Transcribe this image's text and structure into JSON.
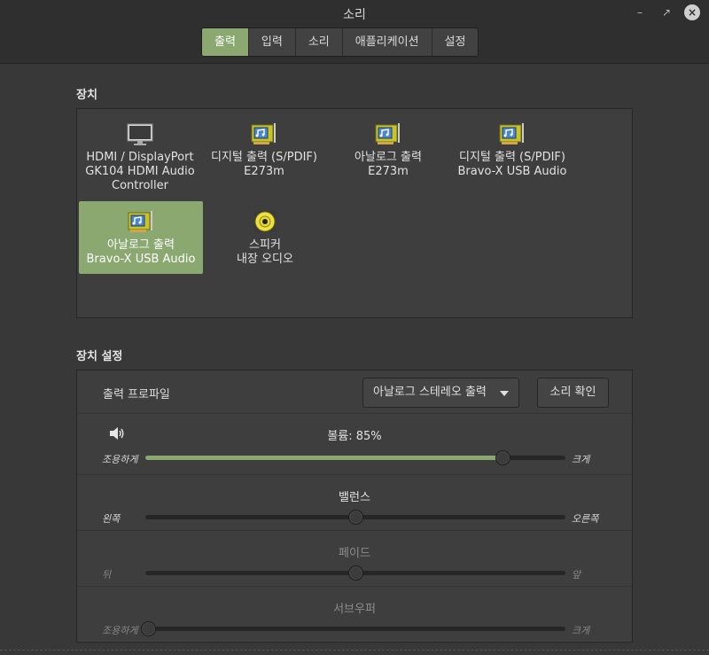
{
  "window": {
    "title": "소리"
  },
  "tabs": [
    {
      "label": "출력",
      "active": true
    },
    {
      "label": "입력",
      "active": false
    },
    {
      "label": "소리",
      "active": false
    },
    {
      "label": "애플리케이션",
      "active": false
    },
    {
      "label": "설정",
      "active": false
    }
  ],
  "devices_section": {
    "label": "장치",
    "devices": [
      {
        "line1": "HDMI / DisplayPort",
        "line2": "GK104 HDMI Audio",
        "line3": "Controller",
        "icon": "monitor-icon",
        "selected": false
      },
      {
        "line1": "디지털 출력 (S/PDIF)",
        "line2": "E273m",
        "icon": "sound-card-icon",
        "selected": false
      },
      {
        "line1": "아날로그 출력",
        "line2": "E273m",
        "icon": "sound-card-icon",
        "selected": false
      },
      {
        "line1": "디지털 출력 (S/PDIF)",
        "line2": "Bravo-X USB Audio",
        "icon": "sound-card-icon",
        "selected": false
      },
      {
        "line1": "아날로그 출력",
        "line2": "Bravo-X USB Audio",
        "icon": "sound-card-icon",
        "selected": true
      },
      {
        "line1": "스피커",
        "line2": "내장 오디오",
        "icon": "speaker-device-icon",
        "selected": false
      }
    ]
  },
  "settings_section": {
    "label": "장치 설정",
    "profile_label": "출력 프로파일",
    "profile_value": "아날로그 스테레오 출력",
    "test_button": "소리 확인",
    "volume": {
      "title": "볼륨: 85%",
      "left": "조용하게",
      "right": "크게",
      "value": 0.85
    },
    "balance": {
      "title": "밸런스",
      "left": "왼쪽",
      "right": "오른쪽",
      "value": 0.5
    },
    "fade": {
      "title": "페이드",
      "left": "뒤",
      "right": "앞",
      "value": 0.5
    },
    "subwoofer": {
      "title": "서브우퍼",
      "left": "조용하게",
      "right": "크게",
      "value": 0.0
    }
  },
  "colors": {
    "accent": "#8aa870",
    "background": "#383838",
    "panel": "#3e3e3e"
  }
}
